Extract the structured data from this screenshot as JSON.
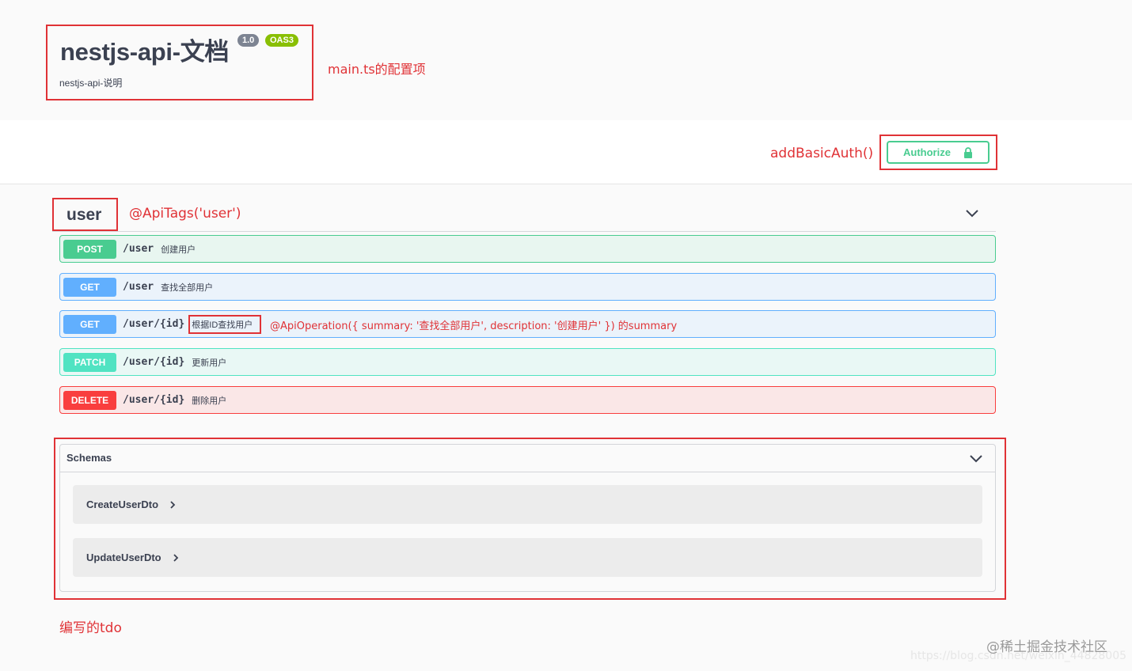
{
  "info": {
    "title": "nestjs-api-文档",
    "version_badge": "1.0",
    "oas_badge": "OAS3",
    "description": "nestjs-api-说明"
  },
  "authorize": {
    "label": "Authorize",
    "icon": "lock-icon"
  },
  "tag": {
    "name": "user",
    "chevron_icon": "chevron-down-icon"
  },
  "operations": [
    {
      "method": "POST",
      "path": "/user",
      "summary": "创建用户"
    },
    {
      "method": "GET",
      "path": "/user",
      "summary": "查找全部用户"
    },
    {
      "method": "GET",
      "path": "/user/{id}",
      "summary": "根据ID查找用户"
    },
    {
      "method": "PATCH",
      "path": "/user/{id}",
      "summary": "更新用户"
    },
    {
      "method": "DELETE",
      "path": "/user/{id}",
      "summary": "删除用户"
    }
  ],
  "schemas": {
    "title": "Schemas",
    "models": [
      {
        "name": "CreateUserDto"
      },
      {
        "name": "UpdateUserDto"
      }
    ]
  },
  "annotations": {
    "main_config": "main.ts的配置项",
    "basic_auth": "addBasicAuth()",
    "api_tags": "@ApiTags('user')",
    "api_operation": "@ApiOperation({ summary: '查找全部用户', description: '创建用户' }) 的summary",
    "dto_note": "编写的tdo"
  },
  "watermark": {
    "brand": "@稀土掘金技术社区",
    "url": "https://blog.csdn.net/weixin_44828005"
  },
  "colors": {
    "post": "#49cc90",
    "get": "#61affe",
    "patch": "#50e3c2",
    "delete": "#f93e3e",
    "annotation_red": "#e03236"
  }
}
